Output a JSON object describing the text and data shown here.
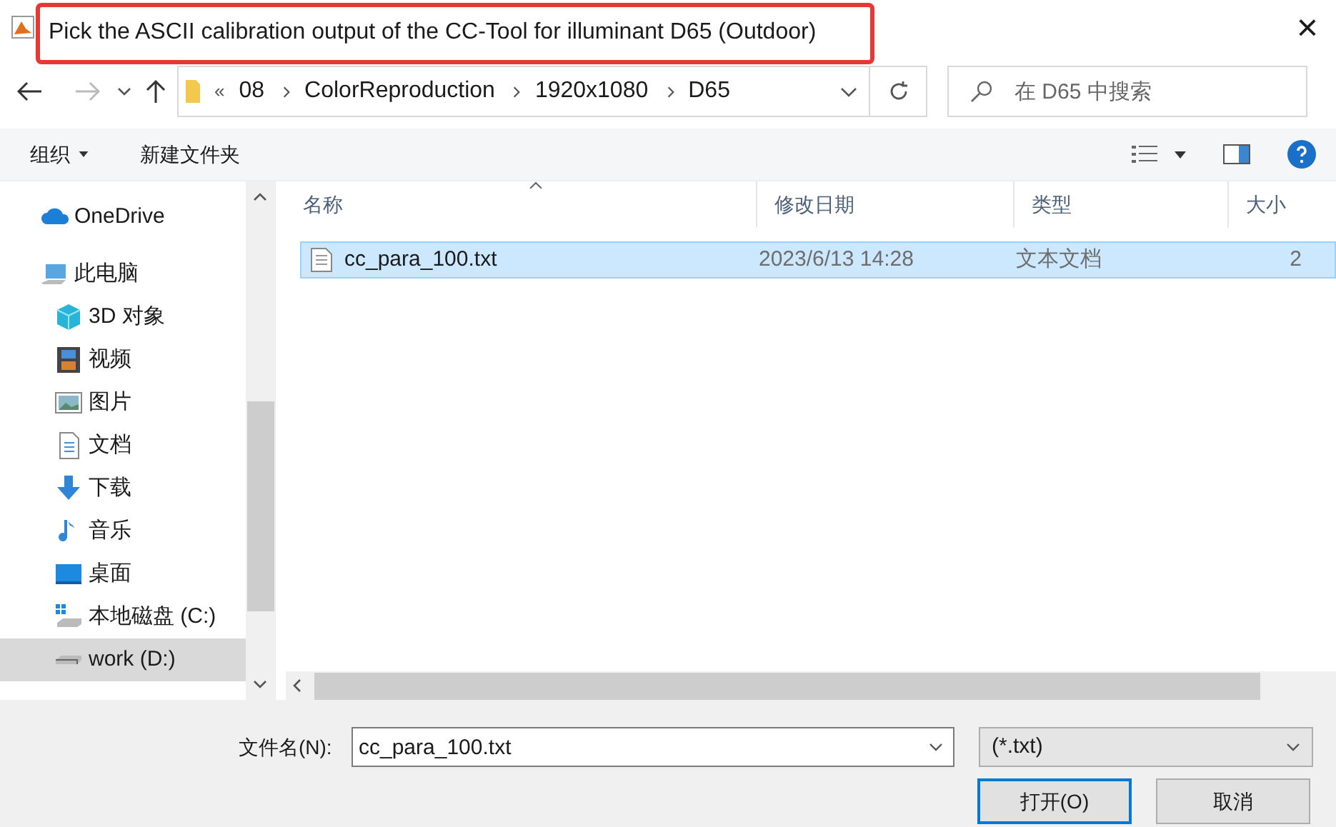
{
  "window": {
    "title": "Pick the ASCII calibration output of the CC-Tool for illuminant D65 (Outdoor)",
    "close": "×"
  },
  "address": {
    "overflow": "«",
    "crumbs": [
      "08",
      "ColorReproduction",
      "1920x1080",
      "D65"
    ]
  },
  "search": {
    "placeholder": "在 D65 中搜索"
  },
  "toolbar": {
    "organize": "组织",
    "new_folder": "新建文件夹"
  },
  "sidebar": {
    "items": [
      {
        "label": "OneDrive",
        "kind": "cloud",
        "selected": false
      },
      {
        "label": "此电脑",
        "kind": "pc",
        "selected": false,
        "children": [
          {
            "label": "3D 对象",
            "kind": "cube",
            "selected": false
          },
          {
            "label": "视频",
            "kind": "video",
            "selected": false
          },
          {
            "label": "图片",
            "kind": "picture",
            "selected": false
          },
          {
            "label": "文档",
            "kind": "document",
            "selected": false
          },
          {
            "label": "下载",
            "kind": "download",
            "selected": false
          },
          {
            "label": "音乐",
            "kind": "music",
            "selected": false
          },
          {
            "label": "桌面",
            "kind": "desktop",
            "selected": false
          },
          {
            "label": "本地磁盘 (C:)",
            "kind": "systemdrive",
            "selected": false
          },
          {
            "label": "work (D:)",
            "kind": "drive",
            "selected": true
          }
        ]
      }
    ]
  },
  "table": {
    "columns": [
      "名称",
      "修改日期",
      "类型",
      "大小"
    ],
    "rows": [
      {
        "name": "cc_para_100.txt",
        "date": "2023/6/13 14:28",
        "type": "文本文档",
        "size": "2",
        "selected": true
      }
    ]
  },
  "footer": {
    "filename_label": "文件名(N):",
    "filename": "cc_para_100.txt",
    "filter": "(*.txt)",
    "open": "打开(O)",
    "cancel": "取消"
  }
}
